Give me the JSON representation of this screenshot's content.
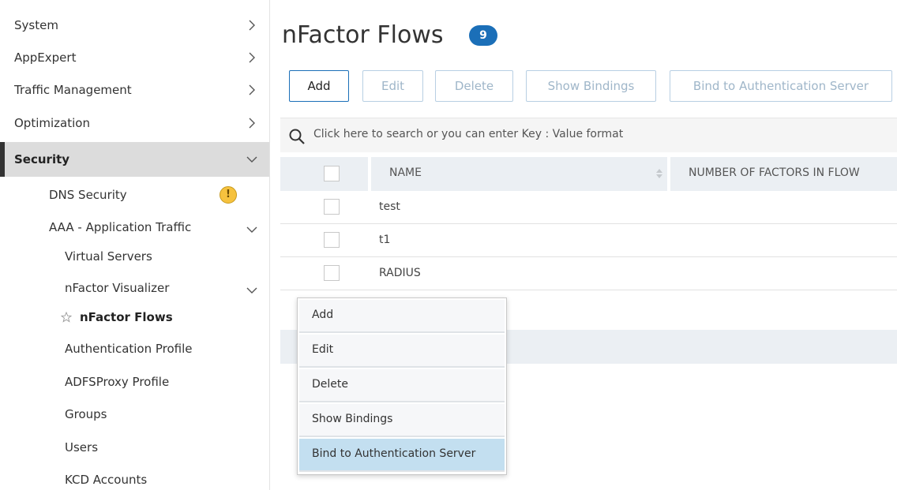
{
  "sidebar": {
    "items": [
      {
        "label": "System"
      },
      {
        "label": "AppExpert"
      },
      {
        "label": "Traffic Management"
      },
      {
        "label": "Optimization"
      },
      {
        "label": "Security"
      }
    ],
    "security_children": [
      {
        "label": "DNS Security",
        "warning": "!"
      },
      {
        "label": "AAA - Application Traffic"
      },
      {
        "label": "Virtual Servers"
      },
      {
        "label": "nFactor Visualizer"
      },
      {
        "label": "nFactor Flows"
      },
      {
        "label": "Authentication Profile"
      },
      {
        "label": "ADFSProxy Profile"
      },
      {
        "label": "Groups"
      },
      {
        "label": "Users"
      },
      {
        "label": "KCD Accounts"
      }
    ]
  },
  "page": {
    "title": "nFactor Flows",
    "count": "9"
  },
  "toolbar": {
    "add_label": "Add",
    "edit_label": "Edit",
    "delete_label": "Delete",
    "show_bindings_label": "Show Bindings",
    "bind_auth_label": "Bind to Authentication Server"
  },
  "search": {
    "placeholder": "Click here to search or you can enter Key : Value format"
  },
  "table": {
    "columns": [
      "NAME",
      "NUMBER OF FACTORS IN FLOW"
    ],
    "rows": [
      {
        "name": "test"
      },
      {
        "name": "t1"
      },
      {
        "name": "RADIUS"
      }
    ]
  },
  "context_menu": {
    "items": [
      {
        "label": "Add"
      },
      {
        "label": "Edit"
      },
      {
        "label": "Delete"
      },
      {
        "label": "Show Bindings"
      },
      {
        "label": "Bind to Authentication Server"
      }
    ]
  },
  "colors": {
    "accent": "#1b6fb8",
    "menu_highlight": "#c3dff0",
    "warning": "#f6c23e"
  }
}
